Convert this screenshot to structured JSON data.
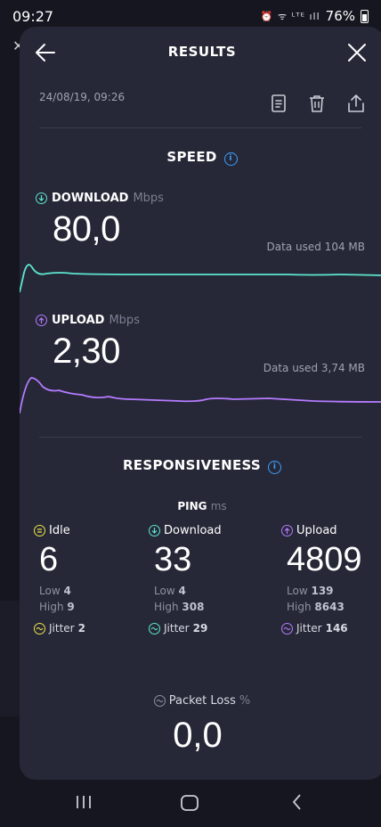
{
  "status_bar": {
    "time": "09:27",
    "icons": "⏰ ᯤ ᴸᵀᴱ ıll",
    "battery": "76%"
  },
  "header": {
    "title": "RESULTS"
  },
  "result": {
    "datetime": "24/08/19, 09:26"
  },
  "speed": {
    "title": "SPEED",
    "download": {
      "label": "DOWNLOAD",
      "unit": "Mbps",
      "value": "80,0",
      "data_used": "Data used 104 MB",
      "color": "#5ee6cf"
    },
    "upload": {
      "label": "UPLOAD",
      "unit": "Mbps",
      "value": "2,30",
      "data_used": "Data used 3,74 MB",
      "color": "#b57bff"
    }
  },
  "responsiveness": {
    "title": "RESPONSIVENESS",
    "ping_label": "PING",
    "ping_unit": "ms",
    "idle": {
      "label": "Idle",
      "value": "6",
      "low_label": "Low",
      "low": "4",
      "high_label": "High",
      "high": "9",
      "jitter_label": "Jitter",
      "jitter": "2",
      "color": "#f0e34a"
    },
    "download": {
      "label": "Download",
      "value": "33",
      "low_label": "Low",
      "low": "4",
      "high_label": "High",
      "high": "308",
      "jitter_label": "Jitter",
      "jitter": "29",
      "color": "#5ee6cf"
    },
    "upload": {
      "label": "Upload",
      "value": "4809",
      "low_label": "Low",
      "low": "139",
      "high_label": "High",
      "high": "8643",
      "jitter_label": "Jitter",
      "jitter": "146",
      "color": "#b57bff"
    },
    "packet_loss": {
      "label": "Packet Loss",
      "unit": "%",
      "value": "0,0"
    }
  }
}
